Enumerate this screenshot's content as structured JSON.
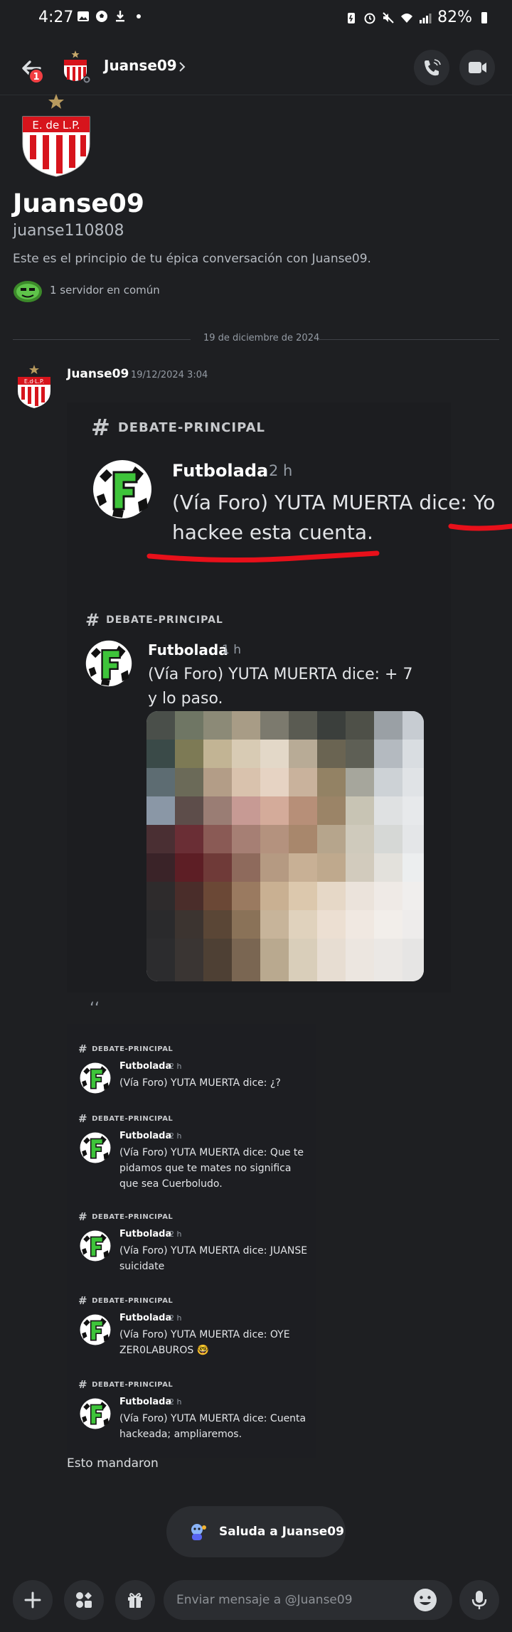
{
  "status_bar": {
    "time": "4:27",
    "battery": "82%"
  },
  "header": {
    "title": "Juanse09",
    "badge": "1"
  },
  "intro": {
    "avatar_text": "E. de L.P.",
    "name": "Juanse09",
    "username": "juanse110808",
    "description": "Este es el principio de tu épica conversación con Juanse09.",
    "mutual": "1 servidor en común"
  },
  "divider": {
    "date": "19 de diciembre de 2024"
  },
  "message": {
    "author": "Juanse09",
    "timestamp": "19/12/2024 3:04",
    "avatar_text": "E.d·L.P.",
    "footer_text": "Esto mandaron"
  },
  "screenshot": {
    "big": {
      "channel": "DEBATE-PRINCIPAL",
      "author": "Futbolada",
      "time": "2 h",
      "text": "(Vía Foro) YUTA MUERTA dice: Yo hackee esta cuenta."
    },
    "medium": {
      "channel": "DEBATE-PRINCIPAL",
      "author": "Futbolada",
      "time": "1 h",
      "text": "(Vía Foro) YUTA MUERTA dice: + 7 y lo paso."
    },
    "quote": "‘‘",
    "small": [
      {
        "channel": "DEBATE-PRINCIPAL",
        "author": "Futbolada",
        "time": "2 h",
        "text": "(Vía Foro) YUTA MUERTA dice: ¿?"
      },
      {
        "channel": "DEBATE-PRINCIPAL",
        "author": "Futbolada",
        "time": "2 h",
        "text": "(Vía Foro) YUTA MUERTA dice: Que te pidamos que te mates no significa que sea Cuerboludo."
      },
      {
        "channel": "DEBATE-PRINCIPAL",
        "author": "Futbolada",
        "time": "2 h",
        "text": "(Vía Foro) YUTA MUERTA dice: JUANSE suicidate"
      },
      {
        "channel": "DEBATE-PRINCIPAL",
        "author": "Futbolada",
        "time": "2 h",
        "text": "(Vía Foro) YUTA MUERTA dice: OYE ZER0LABUROS 🤓"
      },
      {
        "channel": "DEBATE-PRINCIPAL",
        "author": "Futbolada",
        "time": "2 h",
        "text": "(Vía Foro) YUTA MUERTA dice: Cuenta hackeada; ampliaremos."
      }
    ],
    "logo_letter": "F"
  },
  "wave": {
    "label": "Saluda a Juanse09"
  },
  "composer": {
    "placeholder": "Enviar mensaje a @Juanse09"
  },
  "colors": {
    "background": "#1e1f22",
    "accent_red": "#e8101a",
    "badge_red": "#f23f43",
    "futbolada_green": "#3ec43a"
  }
}
